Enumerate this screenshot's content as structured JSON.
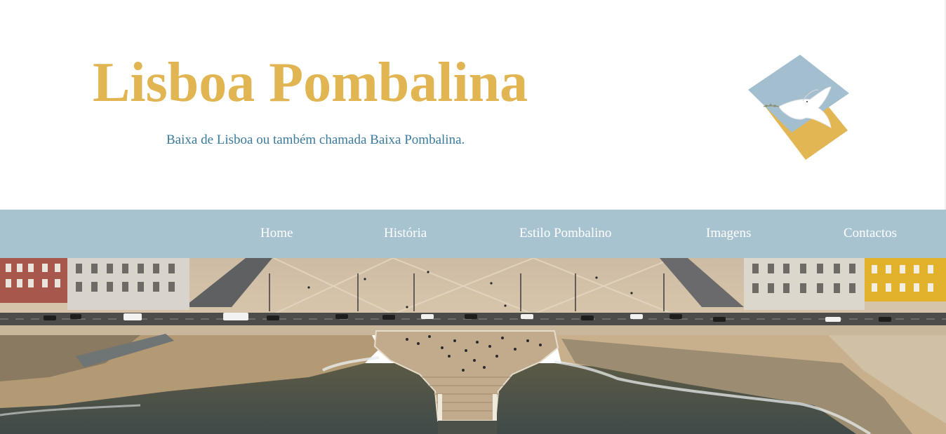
{
  "header": {
    "title": "Lisboa Pombalina",
    "subtitle": "Baixa de Lisboa ou também chamada Baixa Pombalina."
  },
  "logo": {
    "icon": "dove-diamond-logo-icon"
  },
  "nav": {
    "items": [
      {
        "label": "Home"
      },
      {
        "label": "História"
      },
      {
        "label": "Estilo Pombalino"
      },
      {
        "label": "Imagens"
      },
      {
        "label": "Contactos"
      }
    ]
  },
  "hero": {
    "icon": "praca-do-comercio-aerial-photo"
  },
  "colors": {
    "title": "#e0b552",
    "subtitle": "#3a7a9c",
    "nav_background": "#a8c3d0",
    "nav_text": "#ffffff",
    "logo_blue": "#a3bfcf",
    "logo_gold": "#e2b652"
  }
}
